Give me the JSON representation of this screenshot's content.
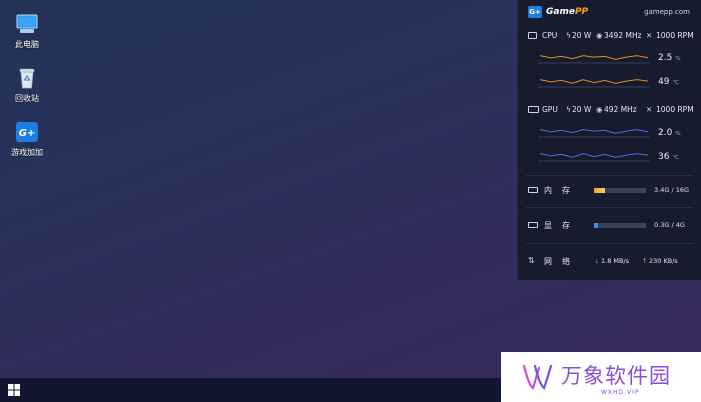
{
  "desktop": {
    "icons": [
      {
        "label": "此电脑",
        "icon": "computer-icon"
      },
      {
        "label": "回收站",
        "icon": "recycle-bin-icon"
      },
      {
        "label": "游戏加加",
        "icon": "gamepp-app-icon"
      }
    ]
  },
  "gamepp": {
    "logo": "G+",
    "brand": "Game",
    "brand_accent": "PP",
    "site": "gamepp.com",
    "cpu": {
      "label": "CPU",
      "power": "20 W",
      "freq": "3492 MHz",
      "fan": "1000 RPM",
      "usage": "2.5",
      "usage_unit": "%",
      "temp": "49",
      "temp_unit": "℃",
      "spark_color": "#e08a2a",
      "usage_history": [
        55,
        40,
        50,
        35,
        55,
        45,
        50,
        30,
        45,
        55,
        40
      ],
      "temp_history": [
        55,
        40,
        50,
        30,
        55,
        35,
        50,
        30,
        45,
        55,
        45
      ]
    },
    "gpu": {
      "label": "GPU",
      "power": "20 W",
      "freq": "492 MHz",
      "fan": "1000 RPM",
      "usage": "2.0",
      "usage_unit": "%",
      "temp": "36",
      "temp_unit": "℃",
      "spark_color": "#3a7be0",
      "usage_history": [
        55,
        40,
        50,
        35,
        55,
        45,
        50,
        30,
        45,
        55,
        40
      ],
      "temp_history": [
        55,
        40,
        50,
        30,
        55,
        35,
        50,
        30,
        45,
        55,
        45
      ]
    },
    "memory": {
      "label_a": "内",
      "label_b": "存",
      "value": "3.4G / 16G",
      "fraction": 0.21,
      "color": "#f0a020"
    },
    "vram": {
      "label_a": "显",
      "label_b": "存",
      "value": "0.3G / 4G",
      "fraction": 0.08,
      "color": "#3a8ef0"
    },
    "network": {
      "label_a": "网",
      "label_b": "络",
      "down": "1.8 MB/s",
      "up": "230 KB/s",
      "down_color": "#3a8ef0",
      "up_color": "#f0a020"
    }
  },
  "watermark": {
    "text": "万象软件园",
    "sub": "WXHD.VIP",
    "color": "#8a4fd6"
  }
}
